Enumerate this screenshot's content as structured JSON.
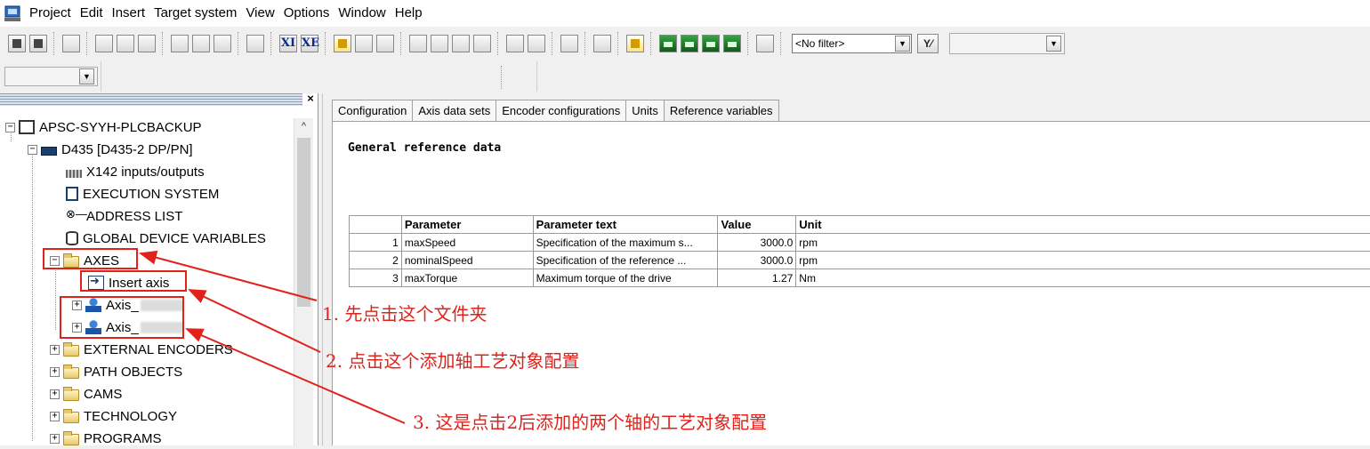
{
  "menubar": {
    "items": [
      "Project",
      "Edit",
      "Insert",
      "Target system",
      "View",
      "Options",
      "Window",
      "Help"
    ]
  },
  "toolbar": {
    "xi_label": "XI",
    "xe_label": "XE",
    "filter_value": "<No filter>",
    "filter_button": "Y⁄"
  },
  "tree": {
    "items": [
      {
        "label": "APSC-SYYH-PLCBACKUP"
      },
      {
        "label": "D435 [D435-2 DP/PN]"
      },
      {
        "label": "X142 inputs/outputs"
      },
      {
        "label": "EXECUTION SYSTEM"
      },
      {
        "label": "ADDRESS LIST"
      },
      {
        "label": "GLOBAL DEVICE VARIABLES"
      },
      {
        "label": "AXES"
      },
      {
        "label": "Insert axis"
      },
      {
        "label": "Axis_"
      },
      {
        "label": "Axis_"
      },
      {
        "label": "EXTERNAL ENCODERS"
      },
      {
        "label": "PATH OBJECTS"
      },
      {
        "label": "CAMS"
      },
      {
        "label": "TECHNOLOGY"
      },
      {
        "label": "PROGRAMS"
      }
    ]
  },
  "tabs": [
    "Configuration",
    "Axis data sets",
    "Encoder configurations",
    "Units",
    "Reference variables"
  ],
  "section_title": "General reference data",
  "table": {
    "headers": [
      "",
      "Parameter",
      "Parameter text",
      "Value",
      "Unit"
    ],
    "rows": [
      [
        "1",
        "maxSpeed",
        "Specification of the maximum s...",
        "3000.0",
        "rpm"
      ],
      [
        "2",
        "nominalSpeed",
        "Specification of the reference ...",
        "3000.0",
        "rpm"
      ],
      [
        "3",
        "maxTorque",
        "Maximum torque of the drive",
        "1.27",
        "Nm"
      ]
    ]
  },
  "annotations": {
    "a1": "1. 先点击这个文件夹",
    "a2": "2. 点击这个添加轴工艺对象配置",
    "a3": "3. 这是点击2后添加的两个轴的工艺对象配置",
    "color": "#e0221b"
  }
}
